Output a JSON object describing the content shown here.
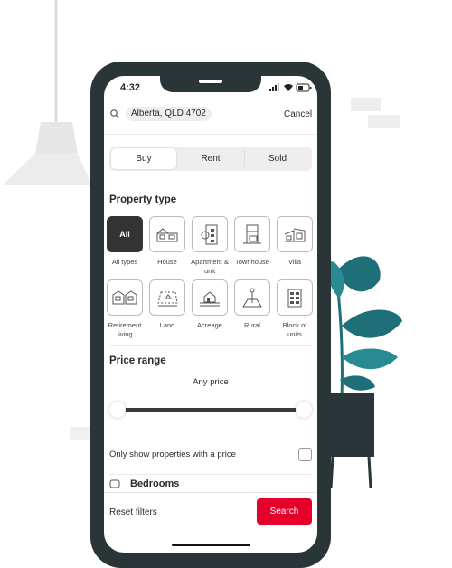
{
  "status_bar": {
    "time": "4:32"
  },
  "search": {
    "location": "Alberta, QLD 4702",
    "cancel_label": "Cancel"
  },
  "tabs": [
    {
      "label": "Buy",
      "selected": true
    },
    {
      "label": "Rent",
      "selected": false
    },
    {
      "label": "Sold",
      "selected": false
    }
  ],
  "property_type": {
    "title": "Property type",
    "items": [
      {
        "tile": "All",
        "label": "All types",
        "icon": "all",
        "selected": true
      },
      {
        "label": "House",
        "icon": "house-icon"
      },
      {
        "label": "Apartment & unit",
        "icon": "apartment-icon"
      },
      {
        "label": "Townhouse",
        "icon": "townhouse-icon"
      },
      {
        "label": "Villa",
        "icon": "villa-icon"
      },
      {
        "label": "Retirement living",
        "icon": "retirement-icon"
      },
      {
        "label": "Land",
        "icon": "land-icon"
      },
      {
        "label": "Acreage",
        "icon": "acreage-icon"
      },
      {
        "label": "Rural",
        "icon": "rural-icon"
      },
      {
        "label": "Block of units",
        "icon": "block-of-units-icon"
      }
    ]
  },
  "price_range": {
    "title": "Price range",
    "value": "Any price",
    "min_fraction": 0,
    "max_fraction": 1
  },
  "price_only": {
    "label": "Only show properties with a price",
    "checked": false
  },
  "bedrooms": {
    "label": "Bedrooms"
  },
  "footer": {
    "reset_label": "Reset filters",
    "search_label": "Search"
  },
  "colors": {
    "accent": "#e4002b",
    "frame": "#2a3538",
    "plant": "#1f6f78"
  }
}
